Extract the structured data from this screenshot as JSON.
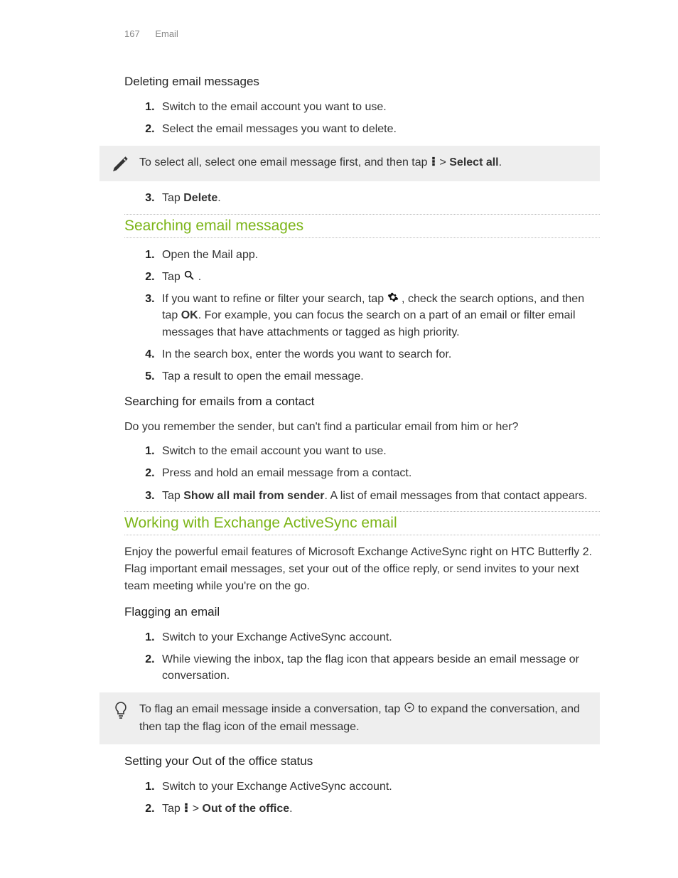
{
  "header": {
    "page_number": "167",
    "section": "Email"
  },
  "deleting": {
    "title": "Deleting email messages",
    "steps_a": [
      "Switch to the email account you want to use.",
      "Select the email messages you want to delete."
    ],
    "note_pre": "To select all, select one email message first, and then tap ",
    "note_post": " > ",
    "note_bold": "Select all",
    "note_end": ".",
    "step3_pre": "Tap ",
    "step3_bold": "Delete",
    "step3_end": "."
  },
  "searching": {
    "title": "Searching email messages",
    "s1": "Open the Mail app.",
    "s2_pre": "Tap ",
    "s2_end": " .",
    "s3_pre": "If you want to refine or filter your search, tap ",
    "s3_mid": ", check the search options, and then tap ",
    "s3_ok": "OK",
    "s3_end": ". For example, you can focus the search on a part of an email or filter email messages that have attachments or tagged as high priority.",
    "s4": "In the search box, enter the words you want to search for.",
    "s5": "Tap a result to open the email message."
  },
  "contact": {
    "title": "Searching for emails from a contact",
    "intro": "Do you remember the sender, but can't find a particular email from him or her?",
    "s1": "Switch to the email account you want to use.",
    "s2": "Press and hold an email message from a contact.",
    "s3_pre": "Tap ",
    "s3_bold": "Show all mail from sender",
    "s3_end": ". A list of email messages from that contact appears."
  },
  "activesync": {
    "title": "Working with Exchange ActiveSync email",
    "intro": "Enjoy the powerful email features of Microsoft Exchange ActiveSync right on HTC Butterfly 2. Flag important email messages, set your out of the office reply, or send invites to your next team meeting while you're on the go.",
    "flag_title": "Flagging an email",
    "flag_s1": "Switch to your Exchange ActiveSync account.",
    "flag_s2": "While viewing the inbox, tap the flag icon that appears beside an email message or conversation.",
    "flag_note_pre": "To flag an email message inside a conversation, tap ",
    "flag_note_post": " to expand the conversation, and then tap the flag icon of the email message.",
    "ooo_title": "Setting your Out of the office status",
    "ooo_s1": "Switch to your Exchange ActiveSync account.",
    "ooo_s2_pre": "Tap ",
    "ooo_s2_mid": " > ",
    "ooo_s2_bold": "Out of the office",
    "ooo_s2_end": "."
  }
}
